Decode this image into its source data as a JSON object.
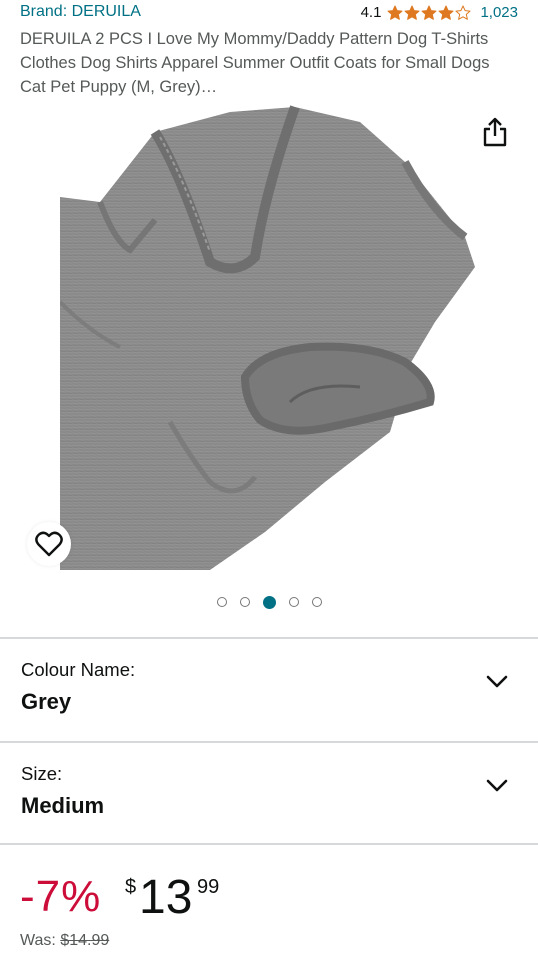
{
  "product": {
    "brand": "Brand: DERUILA",
    "rating_value": "4.1",
    "rating_stars": 4.1,
    "review_count": "1,023",
    "title": "DERUILA 2 PCS I Love My Mommy/Daddy Pattern Dog T-Shirts Clothes Dog Shirts Apparel Summer Outfit Coats for Small Dogs Cat Pet Puppy (M, Grey)…"
  },
  "gallery": {
    "image_count": 5,
    "active_index": 2,
    "image_subject": "grey dog t-shirt",
    "share_icon": "share-icon",
    "wishlist_icon": "heart-icon"
  },
  "options": {
    "colour": {
      "label": "Colour Name:",
      "value": "Grey"
    },
    "size": {
      "label": "Size:",
      "value": "Medium"
    }
  },
  "price": {
    "discount": "-7%",
    "currency": "$",
    "whole": "13",
    "fraction": "99",
    "was_label": "Was:",
    "was_price": "$14.99"
  },
  "colors": {
    "link": "#007185",
    "star": "#de7921",
    "discount": "#cc0c39",
    "active_dot": "#007185"
  }
}
